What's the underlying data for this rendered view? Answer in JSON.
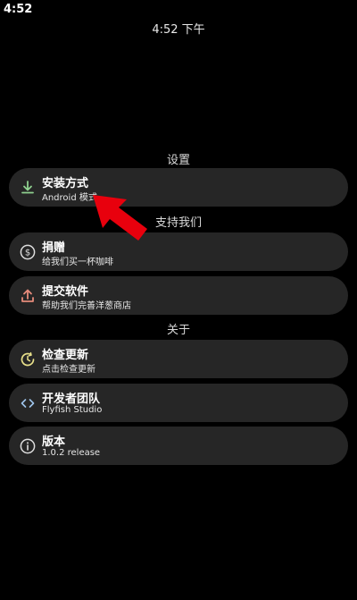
{
  "status_bar": {
    "time": "4:52"
  },
  "clock": {
    "text": "4:52 下午"
  },
  "sections": {
    "settings": "设置",
    "support": "支持我们",
    "about": "关于"
  },
  "items": {
    "install": {
      "title": "安装方式",
      "subtitle": "Android 模式",
      "icon": "download-icon"
    },
    "donate": {
      "title": "捐赠",
      "subtitle": "给我们买一杯咖啡",
      "icon": "dollar-icon"
    },
    "submit": {
      "title": "提交软件",
      "subtitle": "帮助我们完善洋葱商店",
      "icon": "upload-icon"
    },
    "update": {
      "title": "检查更新",
      "subtitle": "点击检查更新",
      "icon": "update-icon"
    },
    "team": {
      "title": "开发者团队",
      "subtitle": "Flyfish Studio",
      "icon": "code-icon"
    },
    "version": {
      "title": "版本",
      "subtitle": "1.0.2 release",
      "icon": "info-icon"
    }
  },
  "colors": {
    "background": "#000000",
    "card": "#262626",
    "download_icon": "#8fd18f",
    "upload_icon": "#e58a7a",
    "update_icon": "#e8e08a",
    "annotation_arrow": "#e8000d"
  }
}
